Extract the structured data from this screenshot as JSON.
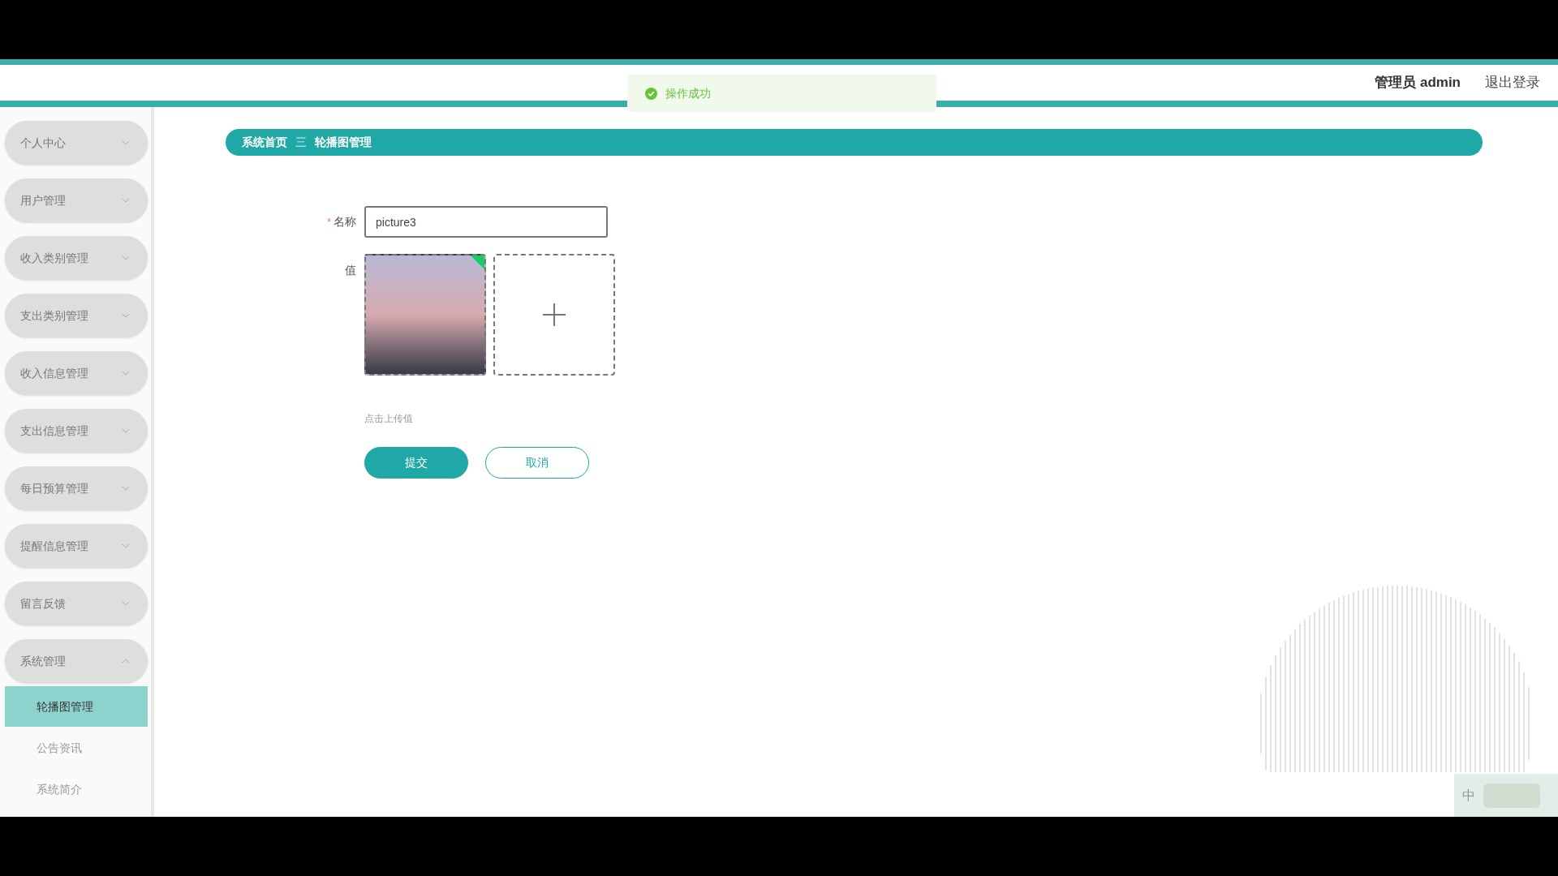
{
  "header": {
    "user_label": "管理员 admin",
    "logout": "退出登录"
  },
  "toast": {
    "message": "操作成功"
  },
  "sidebar": {
    "items": [
      {
        "label": "个人中心",
        "expanded": false
      },
      {
        "label": "用户管理",
        "expanded": false
      },
      {
        "label": "收入类别管理",
        "expanded": false
      },
      {
        "label": "支出类别管理",
        "expanded": false
      },
      {
        "label": "收入信息管理",
        "expanded": false
      },
      {
        "label": "支出信息管理",
        "expanded": false
      },
      {
        "label": "每日预算管理",
        "expanded": false
      },
      {
        "label": "提醒信息管理",
        "expanded": false
      },
      {
        "label": "留言反馈",
        "expanded": false
      },
      {
        "label": "系统管理",
        "expanded": true,
        "children": [
          {
            "label": "轮播图管理",
            "selected": true
          },
          {
            "label": "公告资讯",
            "selected": false
          },
          {
            "label": "系统简介",
            "selected": false
          }
        ]
      }
    ]
  },
  "breadcrumb": {
    "home": "系统首页",
    "separator": "三",
    "current": "轮播图管理"
  },
  "form": {
    "name_field": {
      "label": "名称",
      "required_mark": "*",
      "value": "picture3"
    },
    "value_field": {
      "label": "值",
      "hint": "点击上传值"
    },
    "buttons": [
      {
        "label": "提交",
        "kind": "primary"
      },
      {
        "label": "取消",
        "kind": "secondary"
      }
    ]
  },
  "ime": {
    "mode": "中"
  }
}
